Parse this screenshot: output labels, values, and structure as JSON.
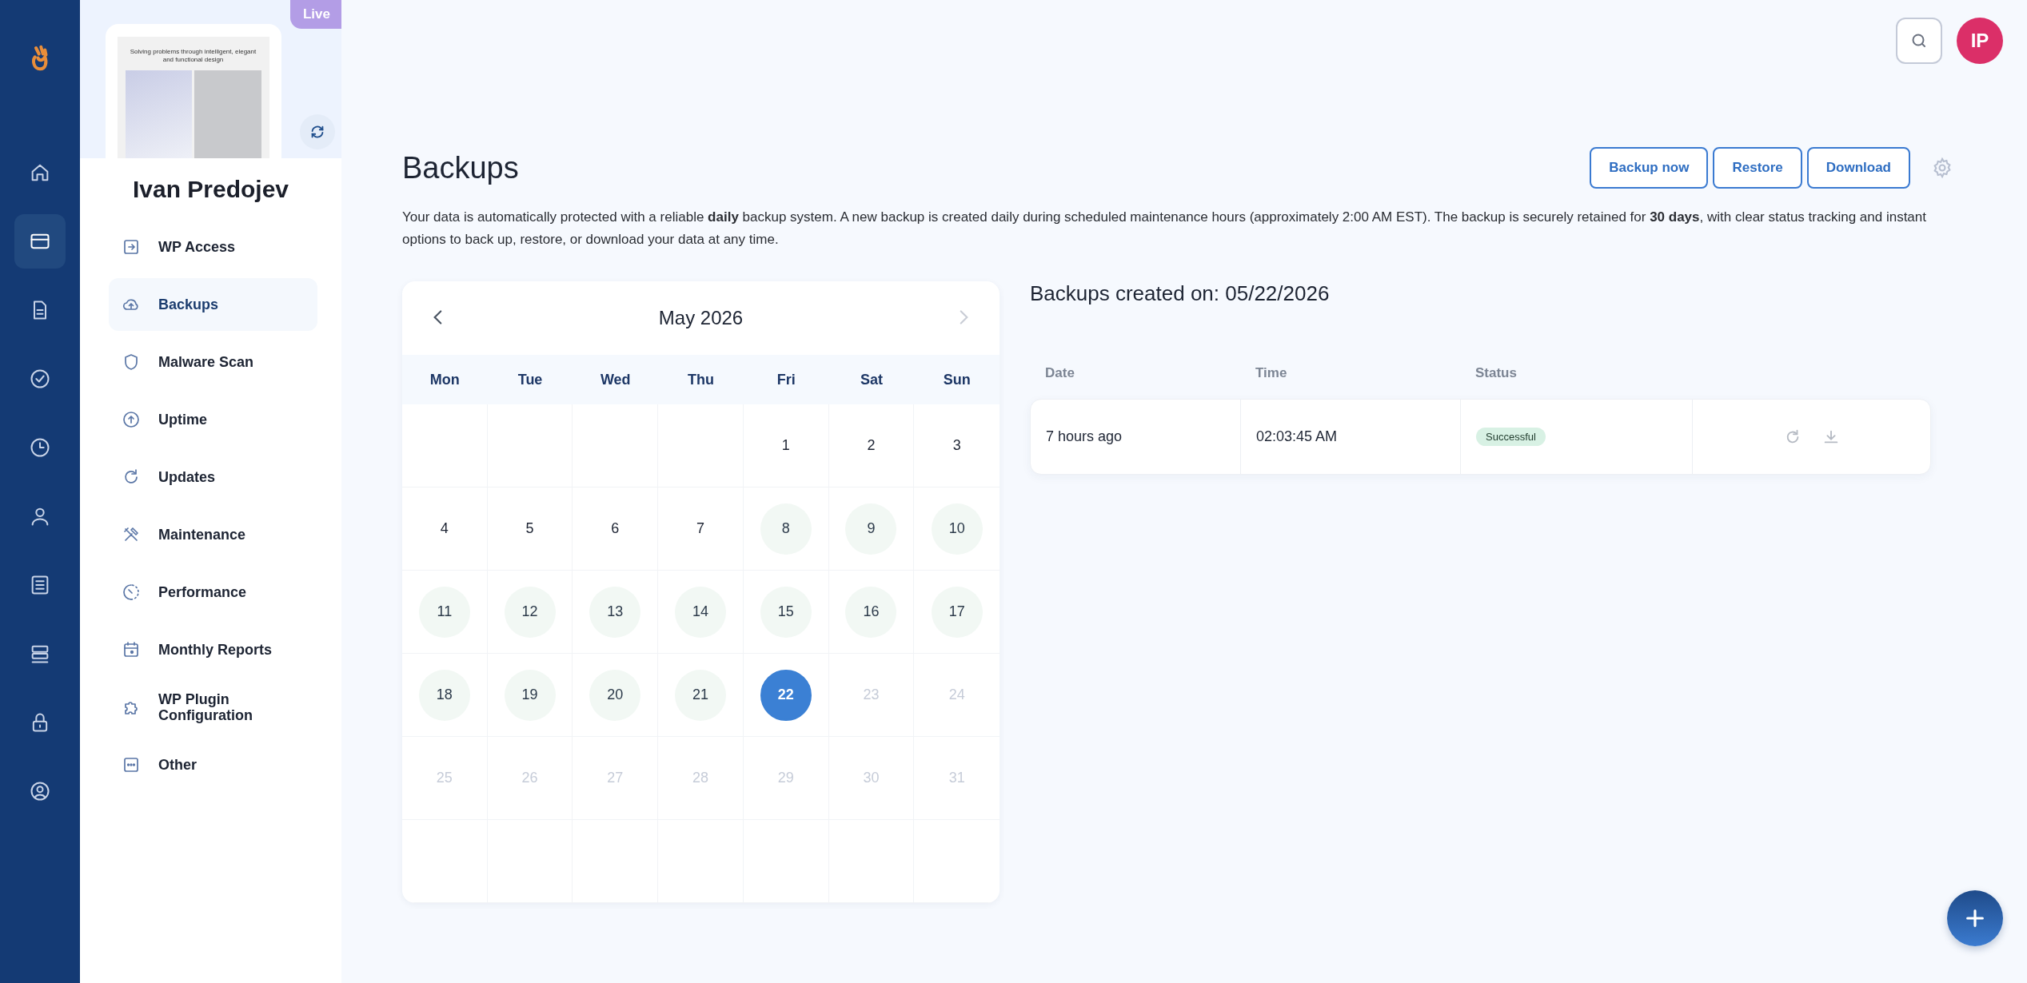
{
  "rail": [
    {
      "selected": false
    },
    {
      "selected": true
    },
    {
      "selected": false
    },
    {
      "selected": false
    },
    {
      "selected": false
    },
    {
      "selected": false
    },
    {
      "selected": false
    },
    {
      "selected": false
    },
    {
      "selected": false
    },
    {
      "selected": false
    }
  ],
  "site": {
    "badge": "Live",
    "preview_headline": "Solving problems through intelligent, elegant and functional design",
    "name": "Ivan Predojev"
  },
  "menu": [
    {
      "label": "WP Access",
      "selected": false
    },
    {
      "label": "Backups",
      "selected": true
    },
    {
      "label": "Malware Scan",
      "selected": false
    },
    {
      "label": "Uptime",
      "selected": false
    },
    {
      "label": "Updates",
      "selected": false
    },
    {
      "label": "Maintenance",
      "selected": false
    },
    {
      "label": "Performance",
      "selected": false
    },
    {
      "label": "Monthly Reports",
      "selected": false
    },
    {
      "label": "WP Plugin Configuration",
      "selected": false
    },
    {
      "label": "Other",
      "selected": false
    }
  ],
  "topbar": {
    "avatar_initials": "IP"
  },
  "page": {
    "title": "Backups",
    "actions": [
      "Backup now",
      "Restore",
      "Download"
    ],
    "description": "Your data is automatically protected with a reliable **daily** backup system. A new backup is created daily during scheduled maintenance hours (approximately 2:00 AM EST). The backup is securely retained for **30 days**, with clear status tracking and instant options to back up, restore, or download your data at any time."
  },
  "calendar": {
    "month": "May 2026",
    "prev_disabled": false,
    "next_disabled": true,
    "weekdays": [
      "Mon",
      "Tue",
      "Wed",
      "Thu",
      "Fri",
      "Sat",
      "Sun"
    ],
    "weeks": [
      [
        {
          "kind": "empty"
        },
        {
          "kind": "empty"
        },
        {
          "kind": "empty"
        },
        {
          "kind": "empty"
        },
        {
          "kind": "day",
          "label": "1",
          "has_backup": false,
          "selected": false,
          "disabled": false
        },
        {
          "kind": "day",
          "label": "2",
          "has_backup": false,
          "selected": false,
          "disabled": false
        },
        {
          "kind": "day",
          "label": "3",
          "has_backup": false,
          "selected": false,
          "disabled": false
        }
      ],
      [
        {
          "kind": "day",
          "label": "4",
          "has_backup": false,
          "selected": false,
          "disabled": false
        },
        {
          "kind": "day",
          "label": "5",
          "has_backup": false,
          "selected": false,
          "disabled": false
        },
        {
          "kind": "day",
          "label": "6",
          "has_backup": false,
          "selected": false,
          "disabled": false
        },
        {
          "kind": "day",
          "label": "7",
          "has_backup": false,
          "selected": false,
          "disabled": false
        },
        {
          "kind": "day",
          "label": "8",
          "has_backup": true,
          "selected": false,
          "disabled": false
        },
        {
          "kind": "day",
          "label": "9",
          "has_backup": true,
          "selected": false,
          "disabled": false
        },
        {
          "kind": "day",
          "label": "10",
          "has_backup": true,
          "selected": false,
          "disabled": false
        }
      ],
      [
        {
          "kind": "day",
          "label": "11",
          "has_backup": true,
          "selected": false,
          "disabled": false
        },
        {
          "kind": "day",
          "label": "12",
          "has_backup": true,
          "selected": false,
          "disabled": false
        },
        {
          "kind": "day",
          "label": "13",
          "has_backup": true,
          "selected": false,
          "disabled": false
        },
        {
          "kind": "day",
          "label": "14",
          "has_backup": true,
          "selected": false,
          "disabled": false
        },
        {
          "kind": "day",
          "label": "15",
          "has_backup": true,
          "selected": false,
          "disabled": false
        },
        {
          "kind": "day",
          "label": "16",
          "has_backup": true,
          "selected": false,
          "disabled": false
        },
        {
          "kind": "day",
          "label": "17",
          "has_backup": true,
          "selected": false,
          "disabled": false
        }
      ],
      [
        {
          "kind": "day",
          "label": "18",
          "has_backup": true,
          "selected": false,
          "disabled": false
        },
        {
          "kind": "day",
          "label": "19",
          "has_backup": true,
          "selected": false,
          "disabled": false
        },
        {
          "kind": "day",
          "label": "20",
          "has_backup": true,
          "selected": false,
          "disabled": false
        },
        {
          "kind": "day",
          "label": "21",
          "has_backup": true,
          "selected": false,
          "disabled": false
        },
        {
          "kind": "day",
          "label": "22",
          "has_backup": true,
          "selected": true,
          "disabled": false
        },
        {
          "kind": "day",
          "label": "23",
          "has_backup": false,
          "selected": false,
          "disabled": true
        },
        {
          "kind": "day",
          "label": "24",
          "has_backup": false,
          "selected": false,
          "disabled": true
        }
      ],
      [
        {
          "kind": "day",
          "label": "25",
          "has_backup": false,
          "selected": false,
          "disabled": true
        },
        {
          "kind": "day",
          "label": "26",
          "has_backup": false,
          "selected": false,
          "disabled": true
        },
        {
          "kind": "day",
          "label": "27",
          "has_backup": false,
          "selected": false,
          "disabled": true
        },
        {
          "kind": "day",
          "label": "28",
          "has_backup": false,
          "selected": false,
          "disabled": true
        },
        {
          "kind": "day",
          "label": "29",
          "has_backup": false,
          "selected": false,
          "disabled": true
        },
        {
          "kind": "day",
          "label": "30",
          "has_backup": false,
          "selected": false,
          "disabled": true
        },
        {
          "kind": "day",
          "label": "31",
          "has_backup": false,
          "selected": false,
          "disabled": true
        }
      ],
      [
        {
          "kind": "empty"
        },
        {
          "kind": "empty"
        },
        {
          "kind": "empty"
        },
        {
          "kind": "empty"
        },
        {
          "kind": "empty"
        },
        {
          "kind": "empty"
        },
        {
          "kind": "empty"
        }
      ]
    ]
  },
  "backups": {
    "title": "Backups created on: 05/22/2026",
    "columns": [
      "Date",
      "Time",
      "Status"
    ],
    "rows": [
      {
        "date": "7 hours ago",
        "time": "02:03:45 AM",
        "status": "Successful"
      }
    ]
  }
}
